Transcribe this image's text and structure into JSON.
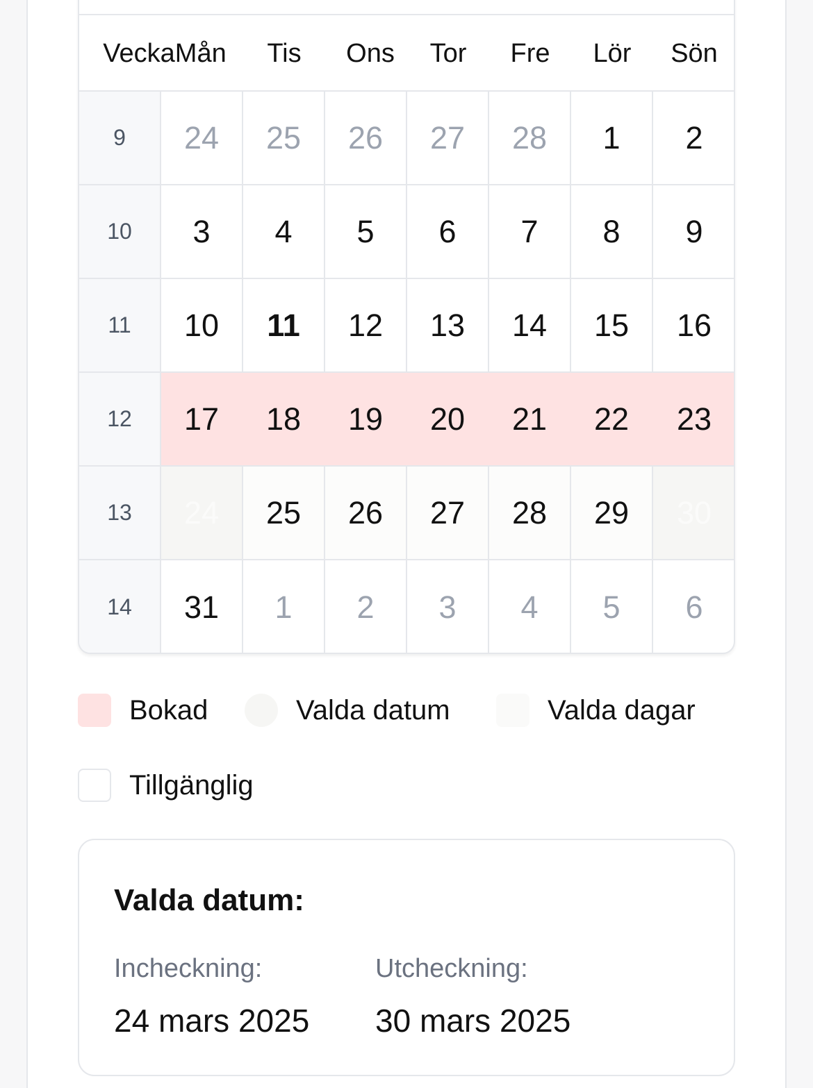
{
  "calendar": {
    "weekdays": [
      "Vecka",
      "Mån",
      "Tis",
      "Ons",
      "Tor",
      "Fre",
      "Lör",
      "Sön"
    ],
    "weeks": [
      {
        "number": "9",
        "days": [
          {
            "label": "24",
            "state": "other"
          },
          {
            "label": "25",
            "state": "other"
          },
          {
            "label": "26",
            "state": "other"
          },
          {
            "label": "27",
            "state": "other"
          },
          {
            "label": "28",
            "state": "other"
          },
          {
            "label": "1",
            "state": ""
          },
          {
            "label": "2",
            "state": ""
          }
        ]
      },
      {
        "number": "10",
        "days": [
          {
            "label": "3",
            "state": ""
          },
          {
            "label": "4",
            "state": ""
          },
          {
            "label": "5",
            "state": ""
          },
          {
            "label": "6",
            "state": ""
          },
          {
            "label": "7",
            "state": ""
          },
          {
            "label": "8",
            "state": ""
          },
          {
            "label": "9",
            "state": ""
          }
        ]
      },
      {
        "number": "11",
        "days": [
          {
            "label": "10",
            "state": ""
          },
          {
            "label": "11",
            "state": "today"
          },
          {
            "label": "12",
            "state": ""
          },
          {
            "label": "13",
            "state": ""
          },
          {
            "label": "14",
            "state": ""
          },
          {
            "label": "15",
            "state": ""
          },
          {
            "label": "16",
            "state": ""
          }
        ]
      },
      {
        "number": "12",
        "days": [
          {
            "label": "17",
            "state": "booked"
          },
          {
            "label": "18",
            "state": "booked"
          },
          {
            "label": "19",
            "state": "booked"
          },
          {
            "label": "20",
            "state": "booked"
          },
          {
            "label": "21",
            "state": "booked"
          },
          {
            "label": "22",
            "state": "booked"
          },
          {
            "label": "23",
            "state": "booked"
          }
        ]
      },
      {
        "number": "13",
        "days": [
          {
            "label": "24",
            "state": "sel-edge"
          },
          {
            "label": "25",
            "state": "sel-mid"
          },
          {
            "label": "26",
            "state": "sel-mid"
          },
          {
            "label": "27",
            "state": "sel-mid"
          },
          {
            "label": "28",
            "state": "sel-mid"
          },
          {
            "label": "29",
            "state": "sel-mid"
          },
          {
            "label": "30",
            "state": "sel-edge"
          }
        ]
      },
      {
        "number": "14",
        "days": [
          {
            "label": "31",
            "state": ""
          },
          {
            "label": "1",
            "state": "other"
          },
          {
            "label": "2",
            "state": "other"
          },
          {
            "label": "3",
            "state": "other"
          },
          {
            "label": "4",
            "state": "other"
          },
          {
            "label": "5",
            "state": "other"
          },
          {
            "label": "6",
            "state": "other"
          }
        ]
      }
    ]
  },
  "legend": {
    "booked": "Bokad",
    "selected_dates": "Valda datum",
    "selected_days": "Valda dagar",
    "available": "Tillgänglig"
  },
  "summary": {
    "title": "Valda datum:",
    "checkin_label": "Incheckning:",
    "checkin_value": "24 mars 2025",
    "checkout_label": "Utcheckning:",
    "checkout_value": "30 mars 2025"
  },
  "colors": {
    "booked": "#fee2e2",
    "selected_edge": "#f6f6f4",
    "selected_mid": "#fcfcfb",
    "border": "#e5e7eb",
    "week_column": "#f7f8fa",
    "muted_text": "#9ca3af"
  }
}
